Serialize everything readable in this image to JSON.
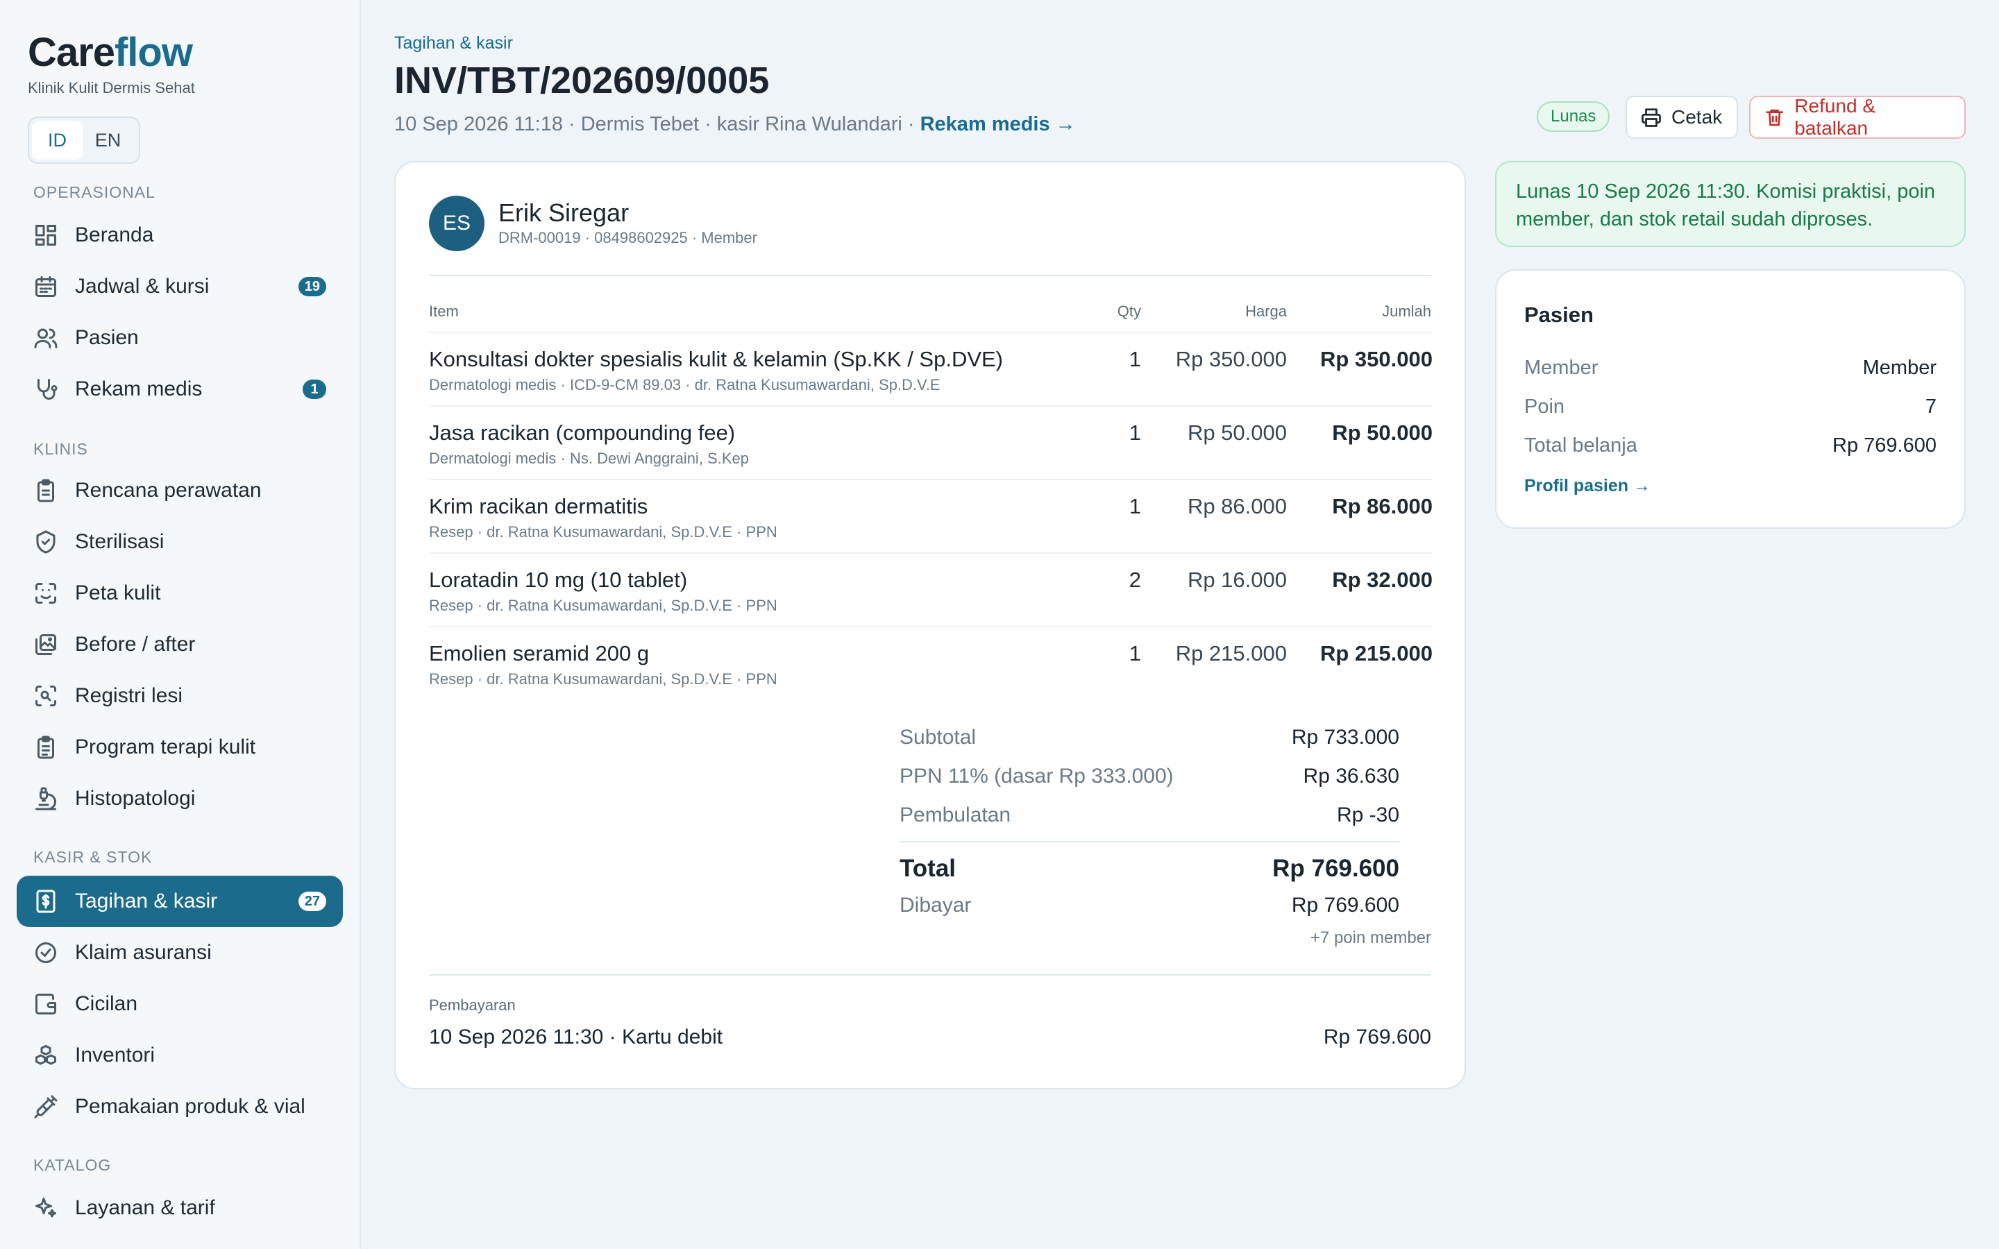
{
  "brand": {
    "name_a": "Care",
    "name_b": "flow",
    "subtitle": "Klinik Kulit Dermis Sehat"
  },
  "lang": {
    "id": "ID",
    "en": "EN",
    "selected": "ID"
  },
  "sidebar": {
    "sections": [
      {
        "label": "OPERASIONAL"
      },
      {
        "label": "KLINIS"
      },
      {
        "label": "KASIR & STOK"
      },
      {
        "label": "KATALOG"
      }
    ],
    "items": [
      {
        "label": "Beranda",
        "icon": "dashboard-icon"
      },
      {
        "label": "Jadwal & kursi",
        "icon": "calendar-icon",
        "badge": "19"
      },
      {
        "label": "Pasien",
        "icon": "users-icon"
      },
      {
        "label": "Rekam medis",
        "icon": "stethoscope-icon",
        "badge": "1"
      },
      {
        "label": "Rencana perawatan",
        "icon": "clipboard-icon"
      },
      {
        "label": "Sterilisasi",
        "icon": "shield-icon"
      },
      {
        "label": "Peta kulit",
        "icon": "face-scan-icon"
      },
      {
        "label": "Before / after",
        "icon": "images-icon"
      },
      {
        "label": "Registri lesi",
        "icon": "scan-search-icon"
      },
      {
        "label": "Program terapi kulit",
        "icon": "clipboard-list-icon"
      },
      {
        "label": "Histopatologi",
        "icon": "microscope-icon"
      },
      {
        "label": "Tagihan & kasir",
        "icon": "receipt-icon",
        "badge": "27",
        "active": true
      },
      {
        "label": "Klaim asuransi",
        "icon": "check-circle-icon"
      },
      {
        "label": "Cicilan",
        "icon": "wallet-icon"
      },
      {
        "label": "Inventori",
        "icon": "boxes-icon"
      },
      {
        "label": "Pemakaian produk & vial",
        "icon": "syringe-icon"
      },
      {
        "label": "Layanan & tarif",
        "icon": "sparkles-icon"
      }
    ]
  },
  "header": {
    "breadcrumb": "Tagihan & kasir",
    "title": "INV/TBT/202609/0005",
    "meta": "10 Sep 2026 11:18 · Dermis Tebet · kasir Rina Wulandari ·",
    "meta_link": "Rekam medis →",
    "status": "Lunas",
    "print_label": "Cetak",
    "refund_label": "Refund & batalkan"
  },
  "invoice": {
    "patient": {
      "initials": "ES",
      "name": "Erik Siregar",
      "sub": "DRM-00019 · 08498602925 · Member"
    },
    "columns": {
      "item": "Item",
      "qty": "Qty",
      "price": "Harga",
      "amount": "Jumlah"
    },
    "rows": [
      {
        "name": "Konsultasi dokter spesialis kulit & kelamin (Sp.KK / Sp.DVE)",
        "sub": "Dermatologi medis  · ICD-9-CM 89.03  · dr. Ratna Kusumawardani, Sp.D.V.E",
        "qty": "1",
        "price": "Rp 350.000",
        "amount": "Rp 350.000"
      },
      {
        "name": "Jasa racikan (compounding fee)",
        "sub": "Dermatologi medis  · Ns. Dewi Anggraini, S.Kep",
        "qty": "1",
        "price": "Rp 50.000",
        "amount": "Rp 50.000"
      },
      {
        "name": "Krim racikan dermatitis",
        "sub": "Resep  · dr. Ratna Kusumawardani, Sp.D.V.E  · PPN",
        "qty": "1",
        "price": "Rp 86.000",
        "amount": "Rp 86.000"
      },
      {
        "name": "Loratadin 10 mg (10 tablet)",
        "sub": "Resep  · dr. Ratna Kusumawardani, Sp.D.V.E  · PPN",
        "qty": "2",
        "price": "Rp 16.000",
        "amount": "Rp 32.000"
      },
      {
        "name": "Emolien seramid 200 g",
        "sub": "Resep  · dr. Ratna Kusumawardani, Sp.D.V.E  · PPN",
        "qty": "1",
        "price": "Rp 215.000",
        "amount": "Rp 215.000"
      }
    ],
    "summary": {
      "subtotal_label": "Subtotal",
      "subtotal": "Rp 733.000",
      "tax_label": "PPN 11% (dasar Rp 333.000)",
      "tax": "Rp 36.630",
      "rounding_label": "Pembulatan",
      "rounding": "Rp -30",
      "total_label": "Total",
      "total": "Rp 769.600",
      "paid_label": "Dibayar",
      "paid": "Rp 769.600",
      "points": "+7 poin member"
    },
    "payment": {
      "label": "Pembayaran",
      "detail": "10 Sep 2026 11:30 · Kartu debit",
      "amount": "Rp 769.600"
    }
  },
  "notice": "Lunas 10 Sep 2026 11:30. Komisi praktisi, poin member, dan stok retail sudah diproses.",
  "patient_card": {
    "title": "Pasien",
    "rows": [
      {
        "k": "Member",
        "v": "Member"
      },
      {
        "k": "Poin",
        "v": "7"
      },
      {
        "k": "Total belanja",
        "v": "Rp 769.600"
      }
    ],
    "link": "Profil pasien →"
  },
  "colors": {
    "accent": "#1a6b8c",
    "success": "#1a8a52",
    "danger": "#c0302a"
  }
}
